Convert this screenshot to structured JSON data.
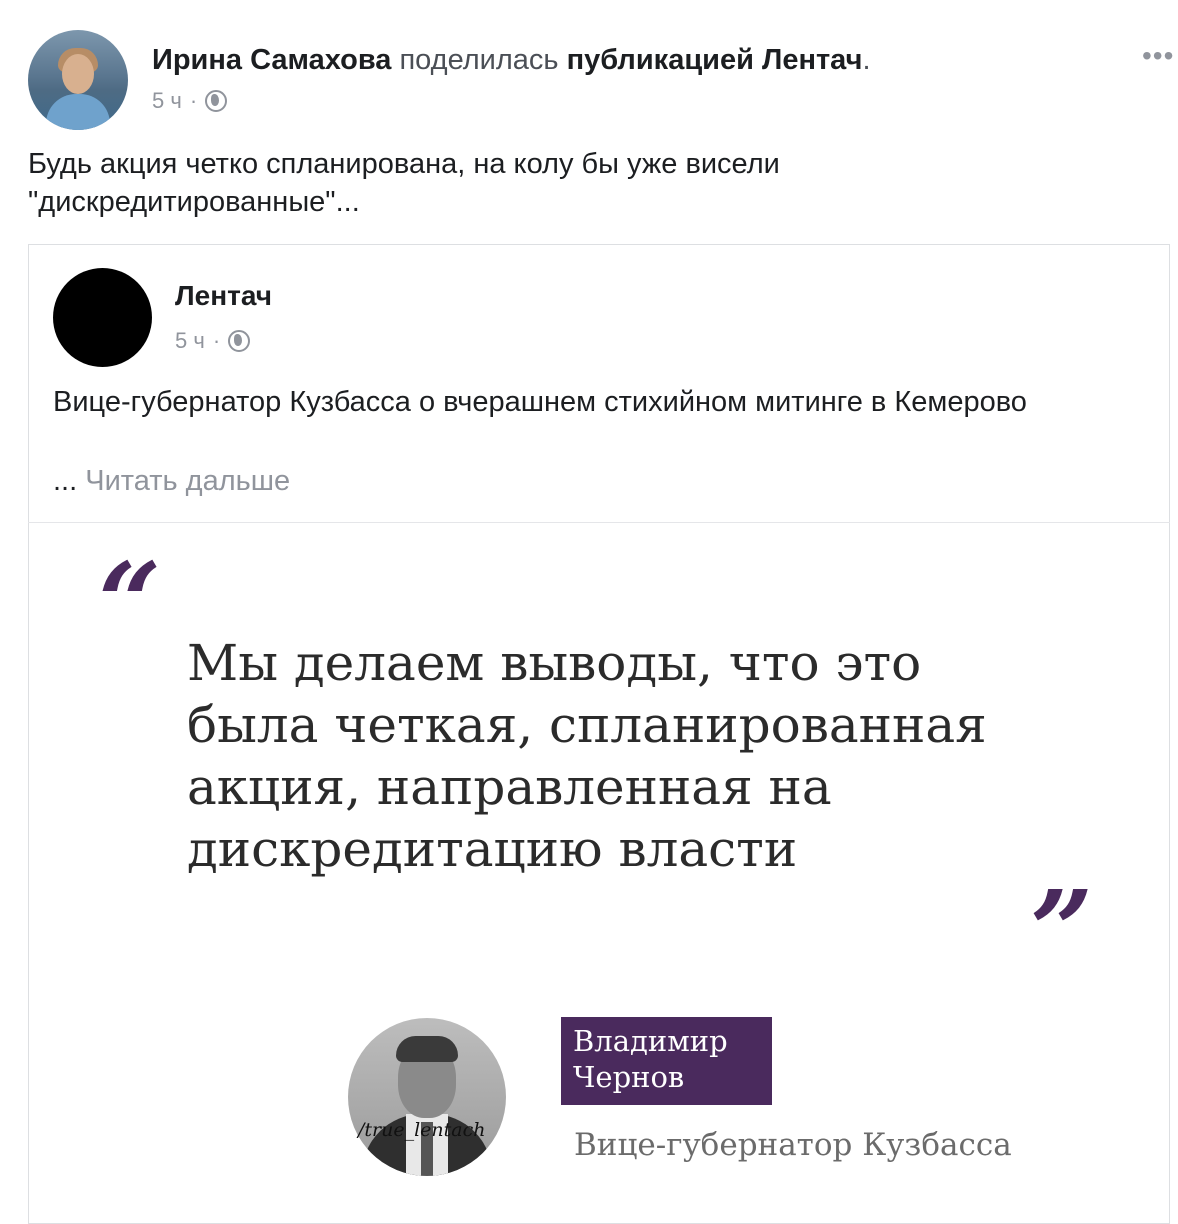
{
  "outer_post": {
    "author": "Ирина Самахова",
    "action_text": "поделилась",
    "target_text": "публикацией Лентач",
    "period": ".",
    "time": "5 ч",
    "dot": "·",
    "text_line1": "Будь акция четко спланирована, на колу бы уже висели",
    "text_line2": "\"дискредитированные\"...",
    "more_label": "•••"
  },
  "shared_post": {
    "author": "Лентач",
    "time": "5 ч",
    "dot": "·",
    "text": "Вице-губернатор Кузбасса о вчерашнем стихийном митинге в Кемерово",
    "ellipsis": "...",
    "read_more": "Читать дальше"
  },
  "quote_image": {
    "open_mark": "“",
    "close_mark": "”",
    "quote_line1": "Мы делаем выводы, что это",
    "quote_line2": "была четкая, спланированная",
    "quote_line3": "акция, направленная на",
    "quote_line4": "дискредитацию власти",
    "watermark": "/true_lentach",
    "name_line1": "Владимир",
    "name_line2": "Чернов",
    "role": "Вице-губернатор Кузбасса",
    "accent_color": "#4a2a5d"
  },
  "icons": {
    "privacy": "globe-icon",
    "more": "more-options-icon"
  }
}
